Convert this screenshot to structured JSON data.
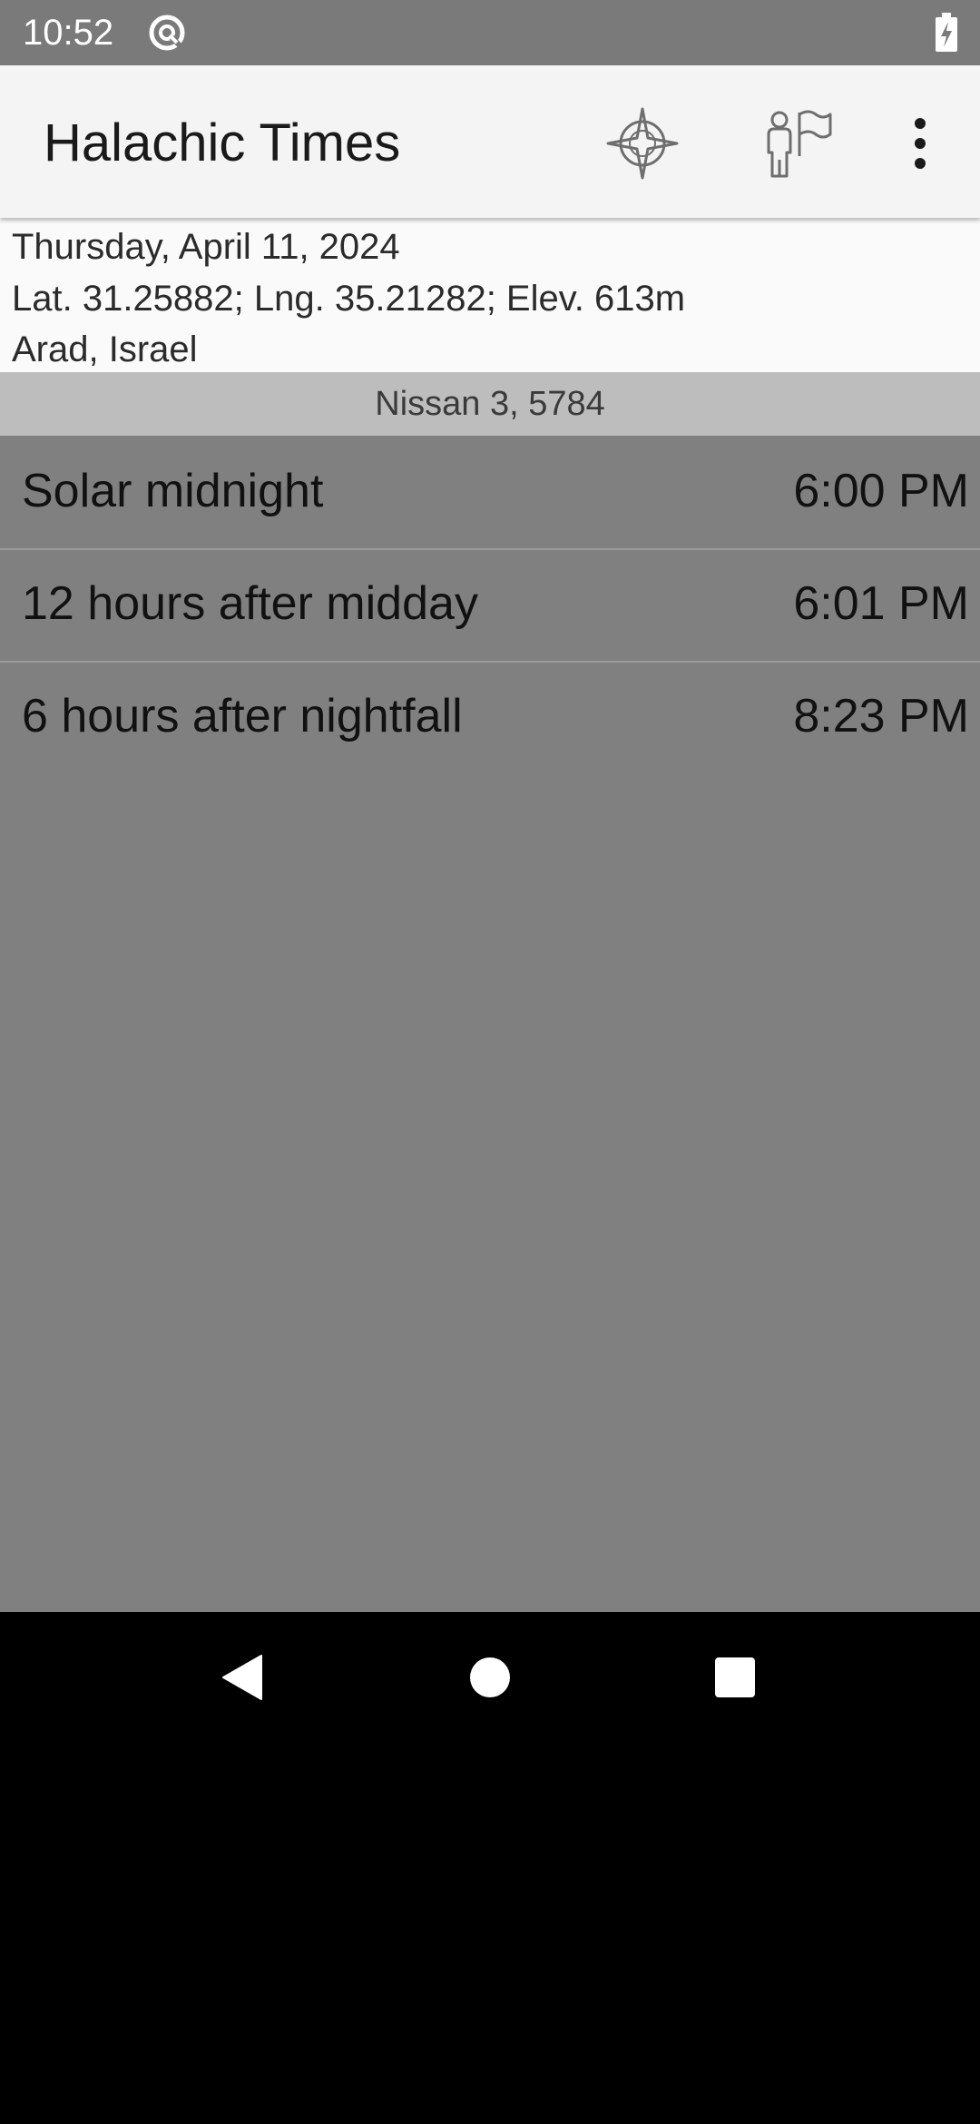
{
  "status_bar": {
    "time": "10:52",
    "icons": [
      "sync-icon",
      "battery-charging-icon"
    ]
  },
  "app_bar": {
    "title": "Halachic Times",
    "actions": [
      "compass-icon",
      "location-person-flag-icon",
      "more-vert-icon"
    ]
  },
  "header": {
    "date": "Thursday, April 11, 2024",
    "coordinates": "Lat. 31.25882; Lng. 35.21282; Elev. 613m",
    "place": "Arad, Israel",
    "hebrew_date": "Nissan 3, 5784"
  },
  "times": [
    {
      "label": "Solar midnight",
      "time": "6:00 PM"
    },
    {
      "label": "12 hours after midday",
      "time": "6:01 PM"
    },
    {
      "label": "6 hours after nightfall",
      "time": "8:23 PM"
    }
  ],
  "nav_bar": {
    "buttons": [
      "back-icon",
      "home-icon",
      "recents-icon"
    ]
  },
  "colors": {
    "status_bar": "#7a7a7a",
    "app_bar": "#f4f4f4",
    "hebrew_bar": "#bdbdbd",
    "list_background": "#808080",
    "nav_bar": "#000000"
  }
}
